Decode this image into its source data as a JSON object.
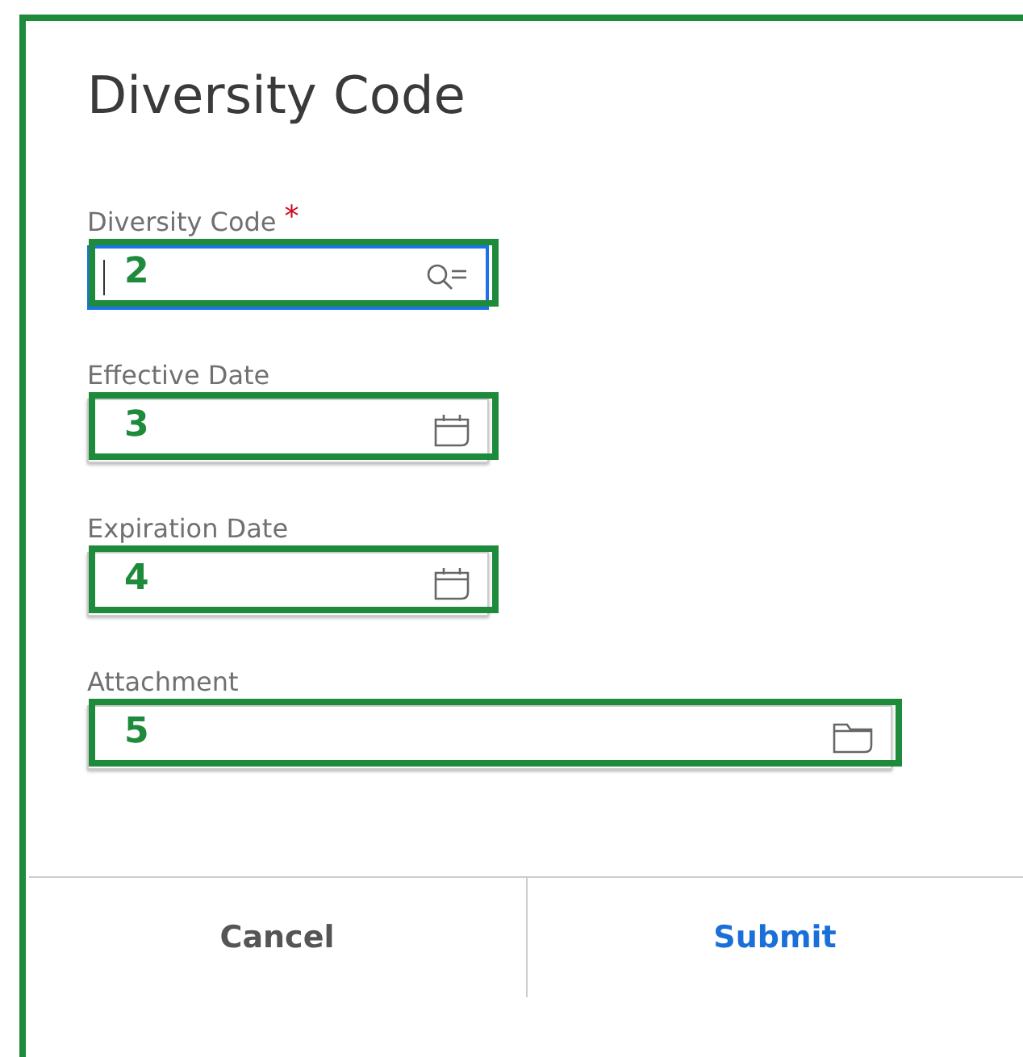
{
  "dialog": {
    "title": "Diversity Code"
  },
  "fields": [
    {
      "label": "Diversity Code",
      "required": true,
      "kind": "search",
      "focused": true,
      "annotation": "2"
    },
    {
      "label": "Effective Date",
      "required": false,
      "kind": "date",
      "focused": false,
      "annotation": "3"
    },
    {
      "label": "Expiration Date",
      "required": false,
      "kind": "date",
      "focused": false,
      "annotation": "4"
    },
    {
      "label": "Attachment",
      "required": false,
      "kind": "file",
      "focused": false,
      "annotation": "5"
    }
  ],
  "required_mark": "*",
  "buttons": [
    {
      "label": "Cancel",
      "kind": "secondary"
    },
    {
      "label": "Submit",
      "kind": "primary"
    }
  ]
}
